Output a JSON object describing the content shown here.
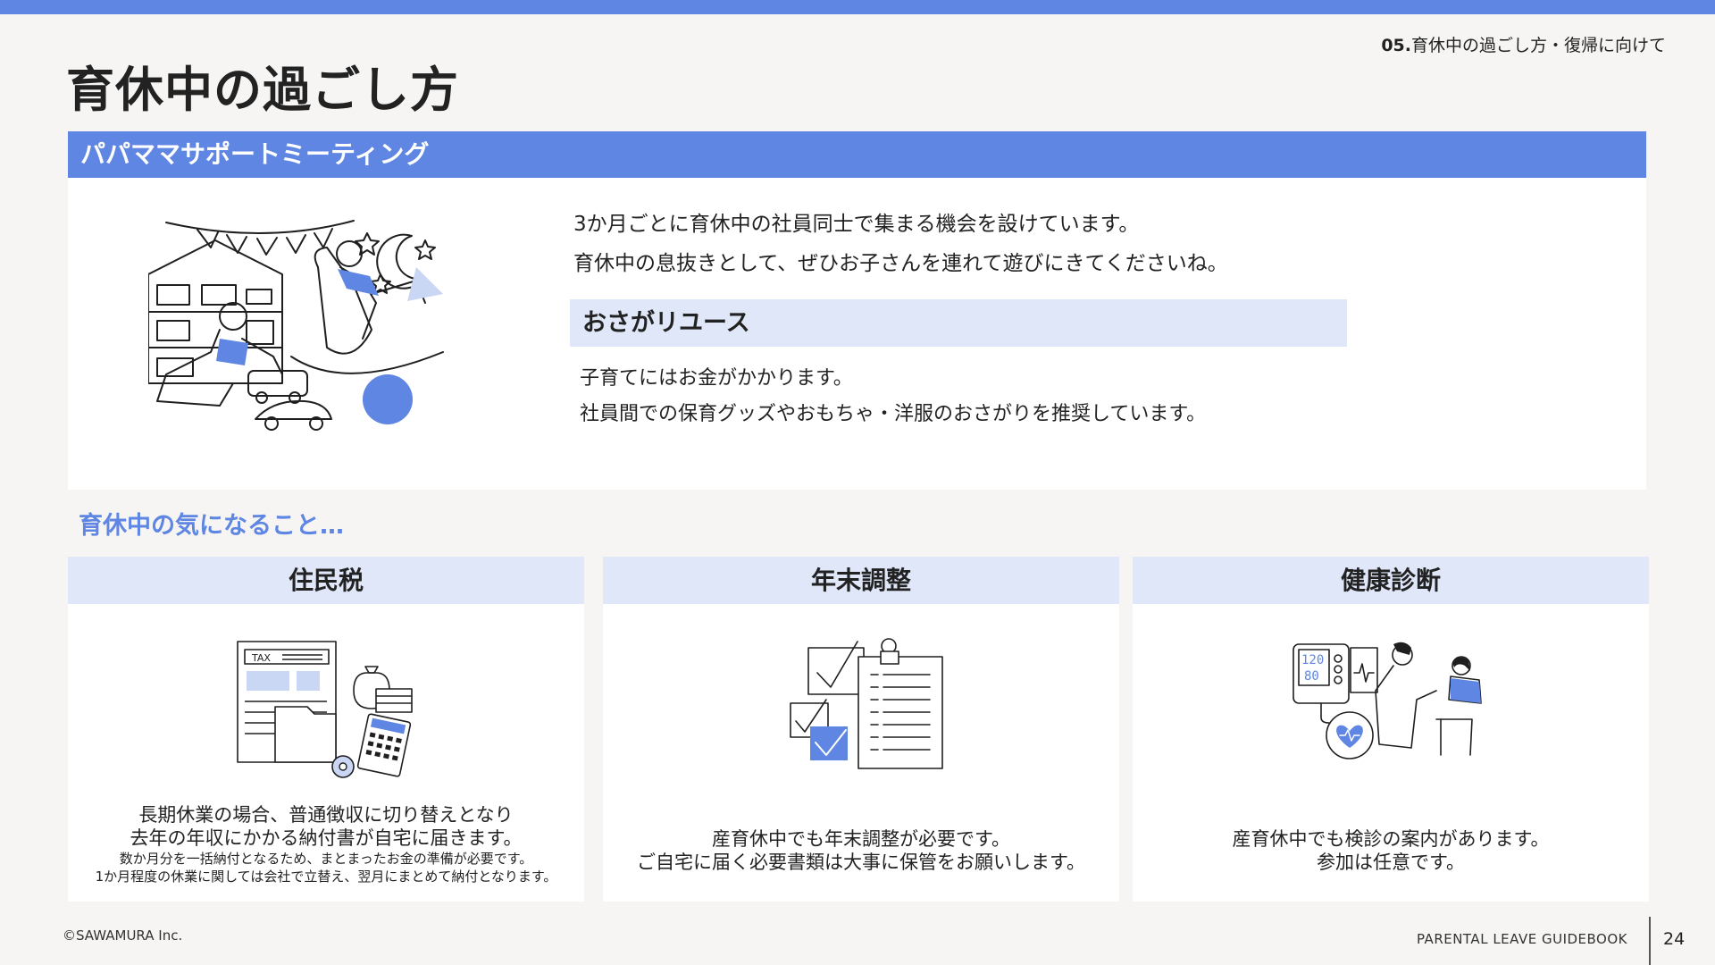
{
  "header": {
    "section_number": "05.",
    "section_title": "育休中の過ごし方・復帰に向けて",
    "page_title": "育休中の過ごし方"
  },
  "meeting": {
    "title": "パパママサポートミーティング",
    "lines": [
      "3か月ごとに育休中の社員同士で集まる機会を設けています。",
      "育休中の息抜きとして、ぜひお子さんを連れて遊びにきてくださいね。"
    ],
    "osagari_title": "おさがリユース",
    "osagari_lines": [
      "子育てにはお金がかかります。",
      "社員間での保育グッズやおもちゃ・洋服のおさがりを推奨しています。"
    ]
  },
  "concerns": {
    "heading": "育休中の気になること…",
    "cards": [
      {
        "title": "住民税",
        "main_lines": [
          "長期休業の場合、普通徴収に切り替えとなり",
          "去年の年収にかかる納付書が自宅に届きます。"
        ],
        "sub_lines": [
          "数か月分を一括納付となるため、まとまったお金の準備が必要です。",
          "1か月程度の休業に関しては会社で立替え、翌月にまとめて納付となります。"
        ],
        "icon": "tax-documents-icon",
        "icon_text": "TAX"
      },
      {
        "title": "年末調整",
        "main_lines": [
          "産育休中でも年末調整が必要です。",
          "ご自宅に届く必要書類は大事に保管をお願いします。"
        ],
        "sub_lines": [],
        "icon": "checklist-clipboard-icon"
      },
      {
        "title": "健康診断",
        "main_lines": [
          "産育休中でも検診の案内があります。",
          "参加は任意です。"
        ],
        "sub_lines": [],
        "icon": "health-checkup-icon",
        "monitor_values": [
          "120",
          "80"
        ]
      }
    ]
  },
  "footer": {
    "copyright": "©SAWAMURA Inc.",
    "title": "PARENTAL LEAVE GUIDEBOOK",
    "page_number": "24"
  },
  "colors": {
    "accent": "#5f86e2",
    "accent_light": "#dfe7f9",
    "background": "#f6f5f4"
  }
}
